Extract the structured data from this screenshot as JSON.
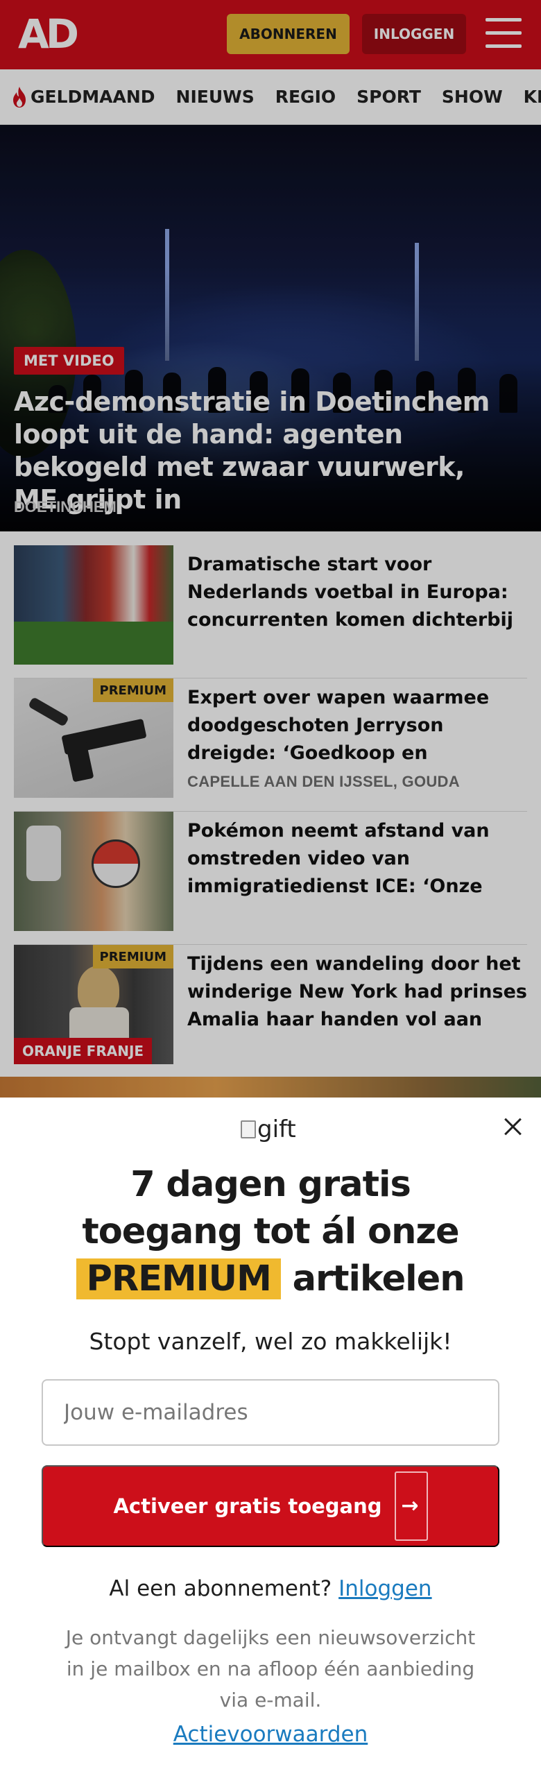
{
  "header": {
    "logo": "AD",
    "subscribe_label": "ABONNEREN",
    "login_label": "INLOGGEN",
    "menu_icon": "hamburger-icon",
    "brand_color": "#ce0e1a",
    "accent_color": "#e3b437"
  },
  "nav": {
    "items": [
      {
        "label": "GELDMAAND",
        "icon": "flame-icon"
      },
      {
        "label": "NIEUWS"
      },
      {
        "label": "REGIO"
      },
      {
        "label": "SPORT"
      },
      {
        "label": "SHOW"
      },
      {
        "label": "KIJK"
      }
    ]
  },
  "hero": {
    "badge": "MET VIDEO",
    "title": "Azc-demonstratie in Doetinchem loopt uit de hand: agenten bekogeld met zwaar vuurwerk, ME grijpt in",
    "location": "DOETINCHEM"
  },
  "articles": [
    {
      "title": "Dramatische start voor Nederlands voetbal in Europa: concurrenten komen dichterbij ..."
    },
    {
      "badge": "PREMIUM",
      "title": "Expert over wapen waarmee doodgeschoten Jerryson dreigde: ‘Goedkoop en makkelij...",
      "location": "CAPELLE AAN DEN IJSSEL, GOUDA"
    },
    {
      "title": "Pokémon neemt afstand van omstreden video van immigratie­dienst ICE: ‘Onze beelden zijn..."
    },
    {
      "badge": "PREMIUM",
      "label": "ORANJE FRANJE",
      "title": "Tijdens een wandeling door het winderige New York had prinses Amalia haar handen vol aan haa..."
    }
  ],
  "modal": {
    "gift_alt": "gift",
    "title_line1": "7 dagen gratis",
    "title_line2": "toegang tot ál onze",
    "title_premium": "PREMIUM",
    "title_line3_rest": "artikelen",
    "subtitle": "Stopt vanzelf, wel zo makkelijk!",
    "email_placeholder": "Jouw e-mailadres",
    "email_value": "",
    "cta_label": "Activeer gratis toegang",
    "cta_icon_alt": "arrow right",
    "already_sub_text": "Al een abonnement?",
    "already_sub_link": "Inloggen",
    "fineprint": "Je ontvangt dagelijks een nieuwsoverzicht in je mailbox en na afloop één aanbieding via e-mail.",
    "terms_link": "Actievoorwaarden",
    "link_color": "#1a7bbf",
    "highlight_color": "#f0b92f"
  }
}
